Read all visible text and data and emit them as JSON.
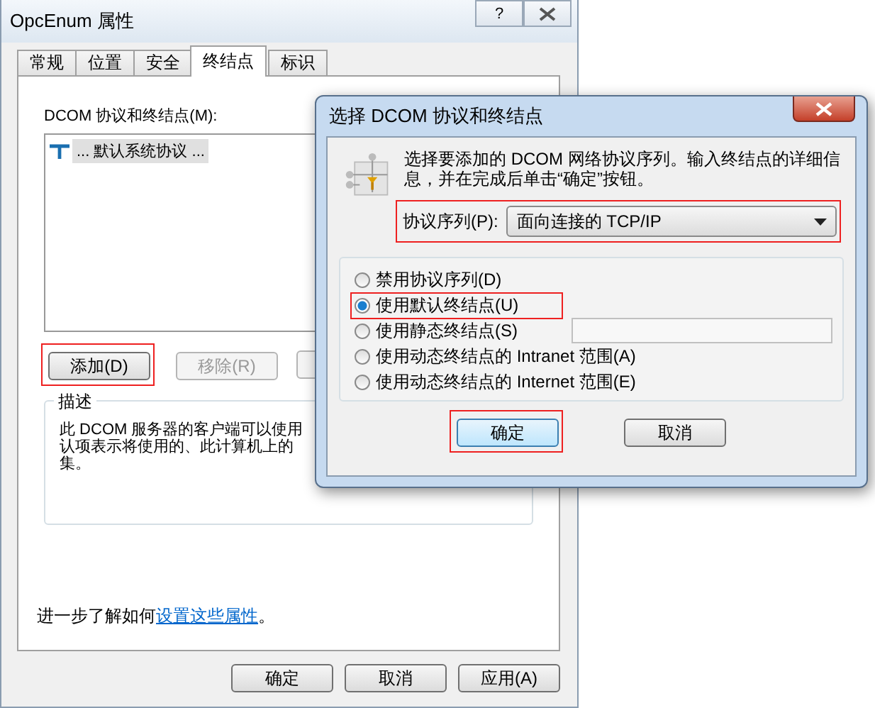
{
  "main_window": {
    "title": "OpcEnum 属性",
    "help": "?",
    "tabs": [
      {
        "label": "常规",
        "selected": false
      },
      {
        "label": "位置",
        "selected": false
      },
      {
        "label": "安全",
        "selected": false
      },
      {
        "label": "终结点",
        "selected": true
      },
      {
        "label": "标识",
        "selected": false
      }
    ],
    "endpoints_label": "DCOM 协议和终结点(M):",
    "endpoints": [
      {
        "label": "... 默认系统协议 ...",
        "selected": true
      }
    ],
    "buttons": [
      {
        "label": "添加(D)",
        "disabled": false,
        "highlighted": true
      },
      {
        "label": "移除(R)",
        "disabled": true,
        "highlighted": false
      }
    ],
    "description": {
      "title": "描述",
      "lines": [
        "此 DCOM 服务器的客户端可以使用",
        "认项表示将使用的、此计算机上的",
        "集。"
      ]
    },
    "learn_more": {
      "text": "进一步了解如何",
      "link": "设置这些属性",
      "end": "。"
    },
    "footer_buttons": [
      "确定",
      "取消",
      "应用(A)"
    ]
  },
  "dialog": {
    "title": "选择 DCOM 协议和终结点",
    "instructions": "选择要添加的 DCOM 网络协议序列。输入终结点的详细信息，并在完成后单击“确定”按钮。",
    "protocol": {
      "label": "协议序列(P):",
      "value": "面向连接的 TCP/IP",
      "highlighted": true
    },
    "options": [
      {
        "label": "禁用协议序列(D)",
        "selected": false,
        "highlighted": false,
        "kind": "plain"
      },
      {
        "label": "使用默认终结点(U)",
        "selected": true,
        "highlighted": true,
        "kind": "plain"
      },
      {
        "label": "使用静态终结点(S)",
        "selected": false,
        "highlighted": false,
        "kind": "field"
      },
      {
        "label": "使用动态终结点的 Intranet 范围(A)",
        "selected": false,
        "highlighted": false,
        "kind": "plain"
      },
      {
        "label": "使用动态终结点的 Internet 范围(E)",
        "selected": false,
        "highlighted": false,
        "kind": "plain"
      }
    ],
    "buttons": [
      {
        "label": "确定",
        "default": true,
        "highlighted": true
      },
      {
        "label": "取消",
        "default": false,
        "highlighted": false
      }
    ]
  }
}
